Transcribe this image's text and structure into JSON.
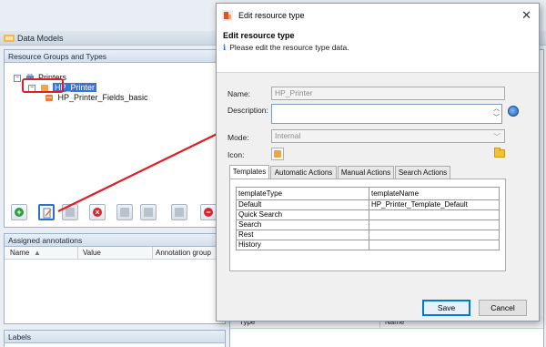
{
  "main_window": {
    "title": "Data Models",
    "resource_panel": {
      "title": "Resource Groups and Types",
      "tree": {
        "root_label": "Printers",
        "selected_label": "HP_Printer",
        "child_label": "HP_Printer_Fields_basic"
      }
    },
    "annotations_panel": {
      "title": "Assigned annotations",
      "columns": [
        "Name",
        "Value",
        "Annotation group"
      ]
    },
    "labels_panel": {
      "title": "Labels"
    },
    "right_grid_columns": [
      "Type",
      "Name"
    ]
  },
  "dialog": {
    "title": "Edit resource type",
    "heading": "Edit resource type",
    "info_text": "Please edit the resource type data.",
    "fields": {
      "name_label": "Name:",
      "name_value": "HP_Printer",
      "description_label": "Description:",
      "description_value": "",
      "mode_label": "Mode:",
      "mode_value": "Internal",
      "icon_label": "Icon:"
    },
    "tabs": [
      "Templates",
      "Automatic Actions",
      "Manual Actions",
      "Search Actions"
    ],
    "selected_tab": "Templates",
    "templates_table": {
      "headers": [
        "templateType",
        "templateName"
      ],
      "rows": [
        [
          "Default",
          "HP_Printer_Template_Default"
        ],
        [
          "Quick Search",
          ""
        ],
        [
          "Search",
          ""
        ],
        [
          "Rest",
          ""
        ],
        [
          "History",
          ""
        ]
      ]
    },
    "buttons": {
      "save": "Save",
      "cancel": "Cancel"
    }
  },
  "colors": {
    "selection": "#3875d7",
    "highlight_box": "#e31b23",
    "arrow": "#e31b23",
    "primary_button_border": "#0078d7"
  }
}
